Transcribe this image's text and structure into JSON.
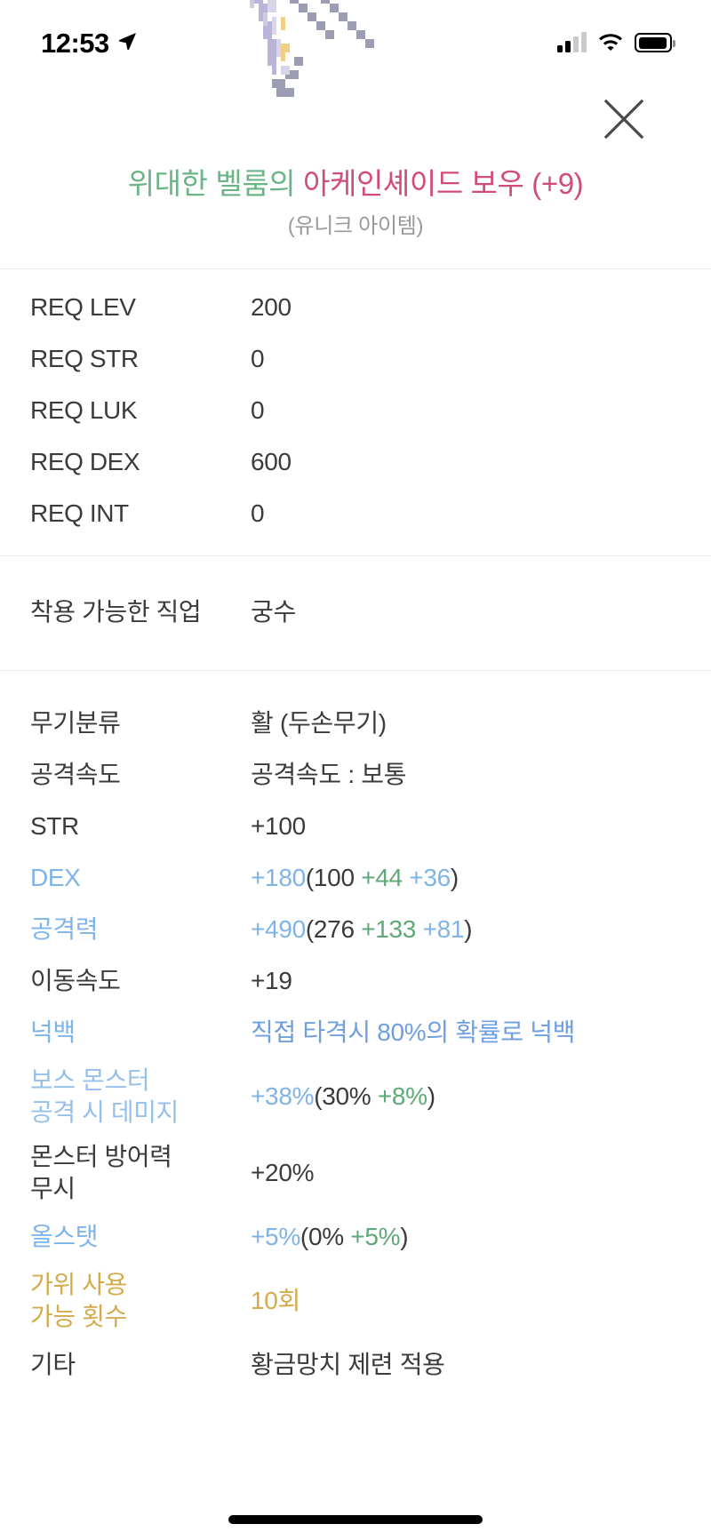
{
  "status_bar": {
    "time": "12:53",
    "location_icon": "location-arrow-icon",
    "cellular_icon": "cellular-signal-icon",
    "wifi_icon": "wifi-icon",
    "battery_icon": "battery-icon"
  },
  "header": {
    "close_icon": "close-icon",
    "item_image": "arcane-shade-bow-pixel-art"
  },
  "title": {
    "prefix": "위대한 벨룸의",
    "main": "아케인셰이드 보우 (+9)",
    "subtitle": "(유니크 아이템)",
    "prefix_color": "#6cb488",
    "main_color": "#d14d77"
  },
  "requirements": [
    {
      "label": "REQ LEV",
      "value": "200"
    },
    {
      "label": "REQ STR",
      "value": "0"
    },
    {
      "label": "REQ LUK",
      "value": "0"
    },
    {
      "label": "REQ DEX",
      "value": "600"
    },
    {
      "label": "REQ INT",
      "value": "0"
    }
  ],
  "job": {
    "label": "착용 가능한 직업",
    "value": "궁수"
  },
  "stats": [
    {
      "label": "무기분류",
      "label_color": "#3b3b3b",
      "parts": [
        {
          "text": "활 (두손무기)",
          "color": "#3b3b3b"
        }
      ]
    },
    {
      "label": "공격속도",
      "label_color": "#3b3b3b",
      "parts": [
        {
          "text": "공격속도 : 보통",
          "color": "#3b3b3b"
        }
      ]
    },
    {
      "label": "STR",
      "label_color": "#3b3b3b",
      "parts": [
        {
          "text": "+100",
          "color": "#3b3b3b"
        }
      ]
    },
    {
      "label": "DEX",
      "label_color": "#7fb4e8",
      "parts": [
        {
          "text": "+180",
          "color": "#7fb4e8"
        },
        {
          "text": "(100 ",
          "color": "#3b3b3b"
        },
        {
          "text": "+44 ",
          "color": "#5fa878"
        },
        {
          "text": "+36",
          "color": "#7fb4e8"
        },
        {
          "text": ")",
          "color": "#3b3b3b"
        }
      ]
    },
    {
      "label": "공격력",
      "label_color": "#7fb4e8",
      "parts": [
        {
          "text": "+490",
          "color": "#7fb4e8"
        },
        {
          "text": "(276 ",
          "color": "#3b3b3b"
        },
        {
          "text": "+133 ",
          "color": "#5fa878"
        },
        {
          "text": "+81",
          "color": "#7fb4e8"
        },
        {
          "text": ")",
          "color": "#3b3b3b"
        }
      ]
    },
    {
      "label": "이동속도",
      "label_color": "#3b3b3b",
      "parts": [
        {
          "text": "+19",
          "color": "#3b3b3b"
        }
      ]
    },
    {
      "label": "넉백",
      "label_color": "#7fb4e8",
      "parts": [
        {
          "text": "직접 타격시 80%의 확률로 넉백",
          "color": "#6f9fe0"
        }
      ]
    },
    {
      "label": "보스 몬스터\n공격 시 데미지",
      "label_color": "#96c0ea",
      "parts": [
        {
          "text": "+38%",
          "color": "#7fb4e8"
        },
        {
          "text": "(30% ",
          "color": "#3b3b3b"
        },
        {
          "text": "+8%",
          "color": "#5fa878"
        },
        {
          "text": ")",
          "color": "#3b3b3b"
        }
      ]
    },
    {
      "label": "몬스터 방어력\n무시",
      "label_color": "#3b3b3b",
      "parts": [
        {
          "text": "+20%",
          "color": "#3b3b3b"
        }
      ]
    },
    {
      "label": "올스탯",
      "label_color": "#7fb4e8",
      "parts": [
        {
          "text": "+5%",
          "color": "#7fb4e8"
        },
        {
          "text": "(0% ",
          "color": "#3b3b3b"
        },
        {
          "text": "+5%",
          "color": "#5fa878"
        },
        {
          "text": ")",
          "color": "#3b3b3b"
        }
      ]
    },
    {
      "label": "가위 사용\n가능 횟수",
      "label_color": "#d3ab4b",
      "parts": [
        {
          "text": "10회",
          "color": "#d3ab4b"
        }
      ]
    },
    {
      "label": "기타",
      "label_color": "#3b3b3b",
      "parts": [
        {
          "text": "황금망치 제련 적용",
          "color": "#3b3b3b"
        }
      ]
    }
  ]
}
